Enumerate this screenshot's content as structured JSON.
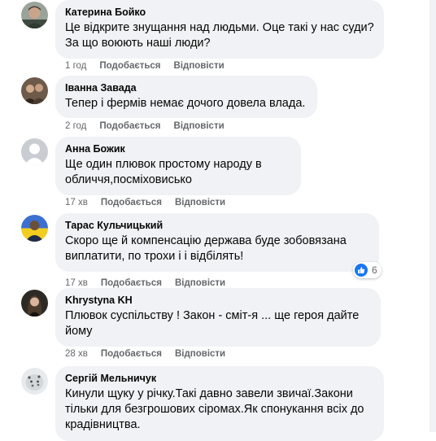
{
  "comments": [
    {
      "author": "Катерина Бойко",
      "text": "Це відкрите знущання над людьми. Оце такі у нас суди? За що воюють наші люди?",
      "time": "1 год",
      "like": "Подобається",
      "reply": "Відповісти",
      "avatar": "avatar-photo-man"
    },
    {
      "author": "Іванна Завада",
      "text": "Тепер і фермів немає дочого довела влада.",
      "time": "2 год",
      "like": "Подобається",
      "reply": "Відповісти",
      "avatar": "avatar-photo-group"
    },
    {
      "author": "Анна Божик",
      "text": "Ще один плювок простому народу в обличчя,посміховисько",
      "time": "17 хв",
      "like": "Подобається",
      "reply": "Відповісти",
      "avatar": "default-avatar-icon"
    },
    {
      "author": "Тарас Кульчицький",
      "text": "Скоро ще й компенсацію держава буде зобовязана виплатити, по трохи і і відбілять!",
      "time": "17 хв",
      "like": "Подобається",
      "reply": "Відповісти",
      "reaction_count": "6",
      "reaction_icon": "thumbs-up-icon",
      "avatar": "avatar-photo-flag"
    },
    {
      "author": "Khrystyna KH",
      "text": "Плювок суспільству ! Закон - сміт-я ... ще героя дайте йому",
      "time": "28 хв",
      "like": "Подобається",
      "reply": "Відповісти",
      "avatar": "avatar-photo-woman"
    },
    {
      "author": "Сергій Мельничук",
      "text": "Кинули щуку у річку.Такі давно завели звичаї.Закони тільки для безгрошових сіромах.Як спонукання всіх до крадівництва.",
      "avatar": "avatar-photo-leopard"
    }
  ],
  "colors": {
    "bubble": "#f0f2f5",
    "meta": "#65676b",
    "like_blue": "#1877f2"
  }
}
